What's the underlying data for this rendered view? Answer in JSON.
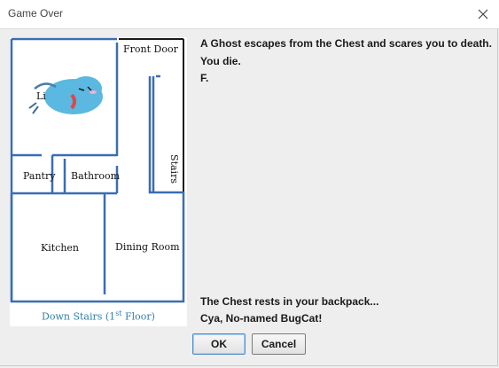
{
  "window": {
    "title": "Game Over",
    "close_icon": "close-icon"
  },
  "map": {
    "rooms": {
      "front_door": "Front Door",
      "living_partial": "Li",
      "stairs": "Stairs",
      "pantry": "Pantry",
      "bathroom": "Bathroom",
      "kitchen": "Kitchen",
      "dining_room": "Dining Room"
    },
    "floor_label": {
      "prefix": "Down Stairs (1",
      "superscript": "st",
      "suffix": " Floor)"
    },
    "player_icon": "bugcat-icon",
    "colors": {
      "walls": "#3a6db5",
      "player": "#5bb8e0",
      "floor_label": "#2f7fa8"
    }
  },
  "messages": {
    "line1": "A Ghost escapes from the Chest and scares you to death.",
    "line2": "You die.",
    "line3": "F.",
    "bottom1": "The Chest rests in your backpack...",
    "bottom2": "Cya, No-named BugCat!"
  },
  "buttons": {
    "ok": "OK",
    "cancel": "Cancel"
  }
}
